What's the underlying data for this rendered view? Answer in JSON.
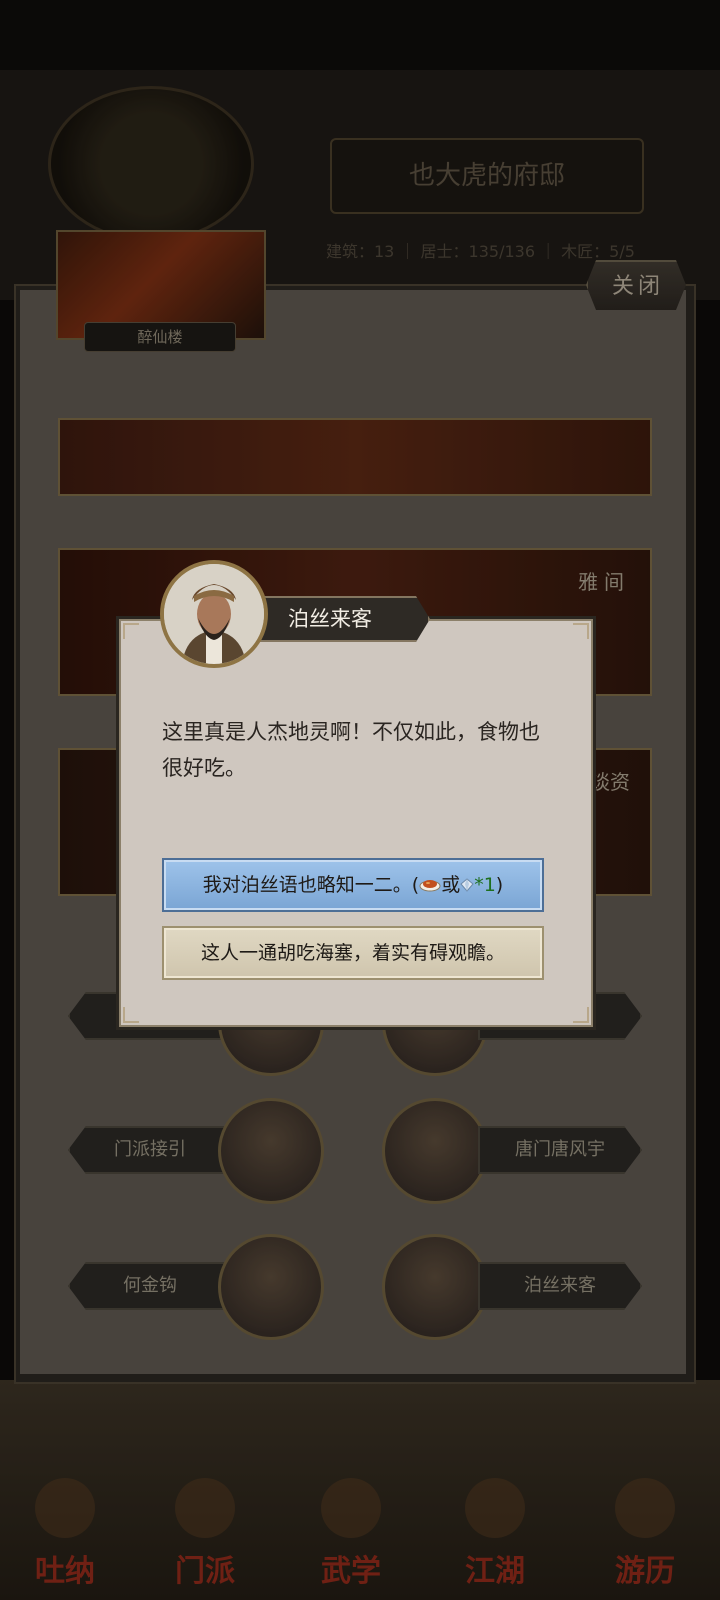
{
  "header": {
    "mansion_title": "也大虎的府邸",
    "stats": "建筑：13 ｜ 居士：135/136 ｜ 木匠：5/5"
  },
  "panel": {
    "close_label": "关闭",
    "building_name": "醉仙楼",
    "room_titles": [
      "雅间",
      "洽谈资"
    ]
  },
  "characters": {
    "left": [
      "门派接引",
      "何金钩"
    ],
    "right": [
      "唐门唐风宇",
      "泊丝来客"
    ]
  },
  "dialog": {
    "speaker": "泊丝来客",
    "text": "这里真是人杰地灵啊！不仅如此，食物也很好吃。",
    "option1_prefix": "我对泊丝语也略知一二。(",
    "option1_or": "或",
    "option1_count": "*1",
    "option1_suffix": ")",
    "option2": "这人一通胡吃海塞，着实有碍观瞻。"
  },
  "bottom_nav": [
    "吐纳",
    "门派",
    "武学",
    "江湖",
    "游历"
  ],
  "colors": {
    "dialog_bg": "#cfc7bf",
    "option_blue": "#8fb6e2",
    "option_tan": "#d8cfb8",
    "count_green": "#1e6f1e"
  }
}
